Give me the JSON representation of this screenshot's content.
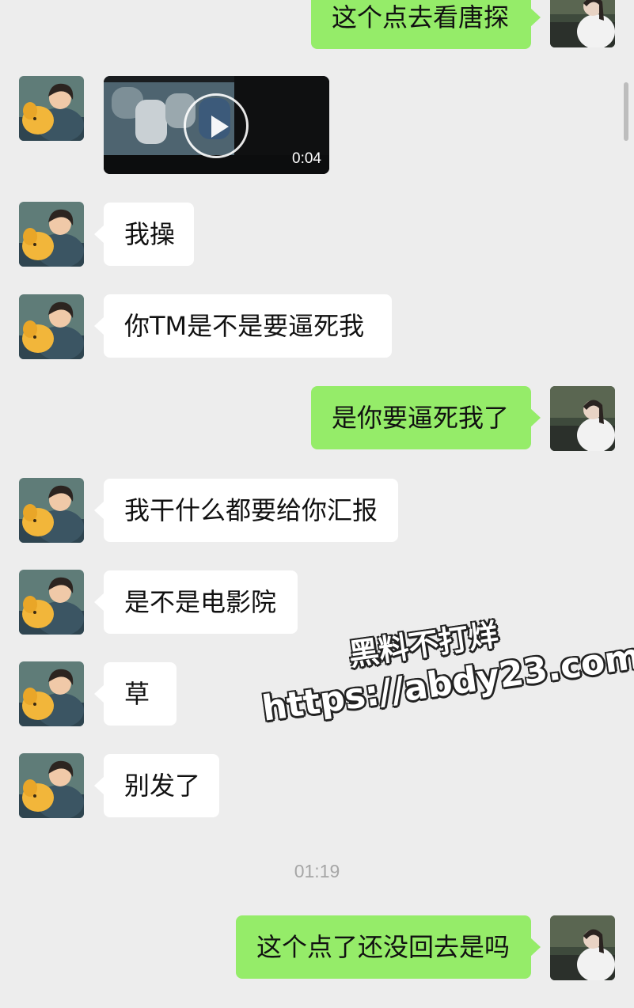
{
  "messages": [
    {
      "text": "这个点去看唐探"
    },
    {
      "duration": "0:04"
    },
    {
      "text": "我操"
    },
    {
      "text": "你TM是不是要逼死我"
    },
    {
      "text": "是你要逼死我了"
    },
    {
      "text": "我干什么都要给你汇报"
    },
    {
      "text": "是不是电影院"
    },
    {
      "text": "草"
    },
    {
      "text": "别发了"
    },
    {
      "text": "这个点了还没回去是吗"
    }
  ],
  "timestamp": "01:19",
  "watermark": {
    "line1": "黑料不打烊",
    "line2": "https://abdy23.com"
  },
  "colors": {
    "background": "#ededed",
    "outgoing_bubble": "#95ec69",
    "incoming_bubble": "#ffffff"
  },
  "icons": [
    "play-icon",
    "avatar-boy-with-dog",
    "avatar-girl-in-white"
  ]
}
